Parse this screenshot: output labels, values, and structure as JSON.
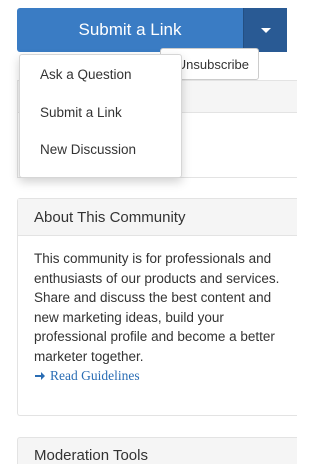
{
  "split_button": {
    "label": "Submit a Link",
    "toggle_icon": "caret-down-icon"
  },
  "dropdown": {
    "items": [
      {
        "label": "Ask a Question"
      },
      {
        "label": "Submit a Link"
      },
      {
        "label": "New Discussion"
      }
    ]
  },
  "subscribe": {
    "unsubscribe_label": "Unsubscribe"
  },
  "about": {
    "title": "About This Community",
    "description": "This community is for professionals and enthusiasts of our products and services. Share and discuss the best content and new marketing ideas, build your professional profile and become a better marketer together.",
    "guidelines_link": "Read Guidelines",
    "link_icon": "arrow-right-icon"
  },
  "moderation": {
    "title": "Moderation Tools"
  },
  "colors": {
    "primary": "#3a7cc4",
    "primary_dark": "#295a94",
    "link": "#2a6db4"
  }
}
